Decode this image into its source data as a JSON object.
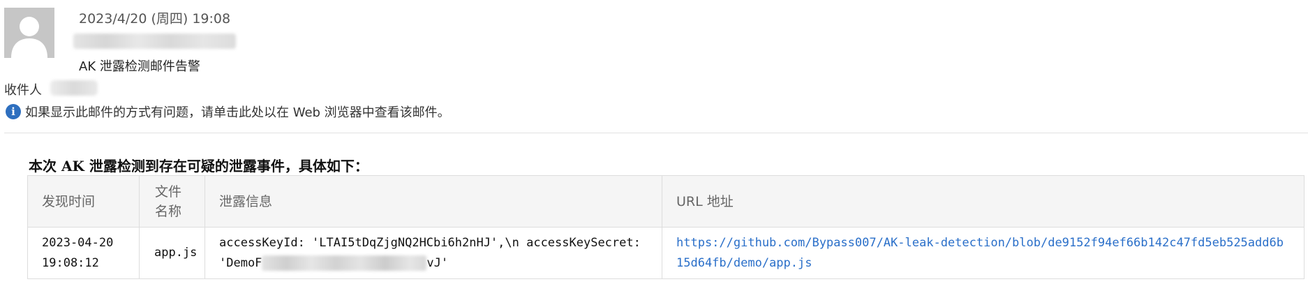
{
  "header": {
    "date": "2023/4/20 (周四) 19:08",
    "subject": "AK 泄露检测邮件告警",
    "recipient_label": "收件人"
  },
  "info_bar": {
    "icon": "info-icon",
    "icon_glyph": "i",
    "text": "如果显示此邮件的方式有问题，请单击此处以在 Web 浏览器中查看该邮件。"
  },
  "content": {
    "title": "本次 AK 泄露检测到存在可疑的泄露事件，具体如下：",
    "table": {
      "headers": [
        "发现时间",
        "文件名称",
        "泄露信息",
        "URL 地址"
      ],
      "rows": [
        {
          "time_date": "2023-04-20",
          "time_clock": "19:08:12",
          "file": "app.js",
          "leak_line1": "accessKeyId: 'LTAI5tDqZjgNQ2HCbi6h2nHJ',\\n accessKeySecret:",
          "leak_line2_prefix": "'DemoF",
          "leak_line2_suffix": "vJ'",
          "url": "https://github.com/Bypass007/AK-leak-detection/blob/de9152f94ef66b142c47fd5eb525add6b15d64fb/demo/app.js"
        }
      ]
    }
  },
  "colors": {
    "link": "#2a6fc9",
    "info_icon": "#2e6fbf",
    "header_bg": "#f5f5f5",
    "border": "#dddddd"
  }
}
